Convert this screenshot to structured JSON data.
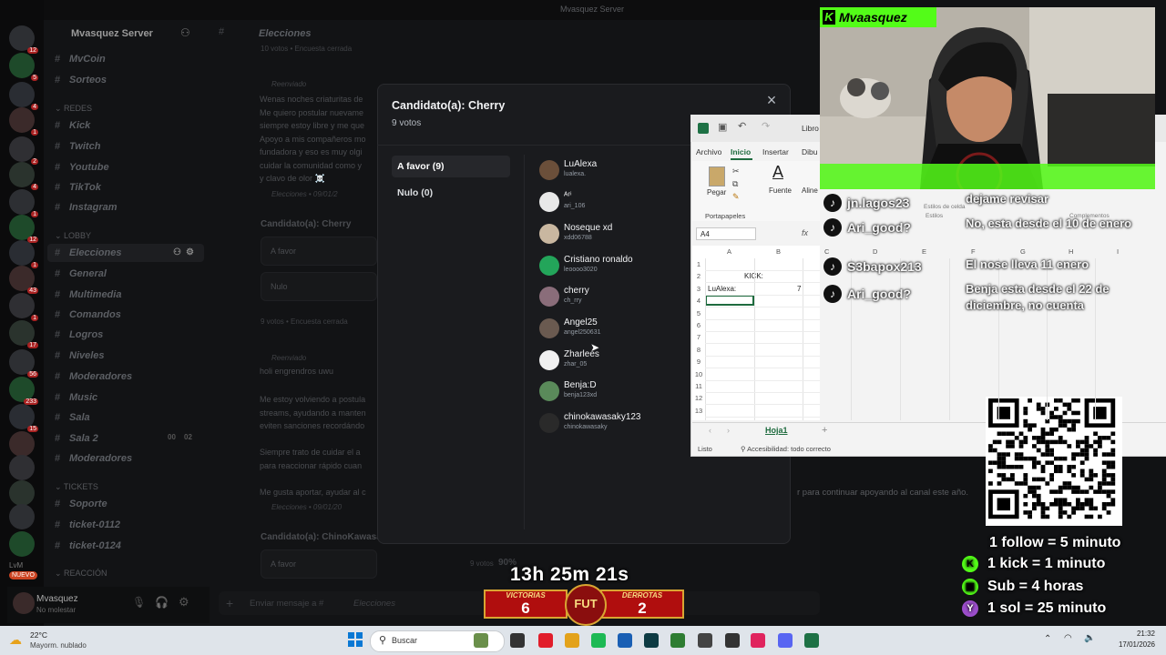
{
  "server": {
    "name": "Mvasquez Server",
    "top_title": "Mvasquez Server",
    "channel_header": "Elecciones",
    "rail_badges": [
      "12",
      "5",
      "4",
      "1",
      "2",
      "4",
      "1",
      "12",
      "1",
      "43",
      "1",
      "17",
      "56",
      "233",
      "15"
    ]
  },
  "sidebar": {
    "channels_top": [
      {
        "label": "MvCoin"
      },
      {
        "label": "Sorteos"
      }
    ],
    "cat_redes": "REDES",
    "redes": [
      {
        "label": "Kick",
        "color": "#53fc18"
      },
      {
        "label": "Twitch",
        "color": "#9146ff"
      },
      {
        "label": "Youtube",
        "color": "#ff0000"
      },
      {
        "label": "TikTok",
        "color": "#ff0050"
      },
      {
        "label": "Instagram",
        "color": "#e1306c"
      }
    ],
    "cat_lobby": "LOBBY",
    "lobby": [
      {
        "label": "Elecciones",
        "active": true
      },
      {
        "label": "General"
      },
      {
        "label": "Multimedia"
      },
      {
        "label": "Comandos"
      },
      {
        "label": "Logros"
      },
      {
        "label": "Niveles"
      },
      {
        "label": "Moderadores"
      },
      {
        "label": "Music"
      },
      {
        "label": "Sala"
      },
      {
        "label": "Sala 2"
      },
      {
        "label": "Moderadores"
      }
    ],
    "sala2_counts": [
      "00",
      "02"
    ],
    "cat_tickets": "TICKETS",
    "tickets": [
      {
        "label": "Soporte"
      },
      {
        "label": "ticket-0112"
      },
      {
        "label": "ticket-0124"
      }
    ],
    "cat_reaccion": "REACCIÓN",
    "nuevo_badge": "NUEVO",
    "user": {
      "name": "Mvasquez",
      "status": "No molestar",
      "initials": "LvM"
    }
  },
  "chat": {
    "reenviado": "Reenviado",
    "msg1": "Wenas noches criaturitas de\nMe quiero postular nuevame\nsiempre estoy libre y me que\nApoyo a mis compañeros mo\nfundadora y eso es muy olgi\ncuidar la comunidad como y\ny clavo de olor ☠️",
    "msg1_meta": "Elecciones • 09/01/2",
    "poll1_title": "Candidato(a): Cherry",
    "poll1_opts": [
      "A favor",
      "Nulo"
    ],
    "poll1_votes": "9 votos",
    "poll1_closed": "Encuesta cerrada",
    "top_votes": "10 votos",
    "top_closed": "Encuesta cerrada",
    "msg2_head": "holi engrendros uwu",
    "msg2": "Me estoy volviendo a postula\nstreams, ayudando a manten\neviten sanciones recordándo\n\nSiempre trato de cuidar el a\npara reaccionar rápido cuan\n\nMe gusta aportar, ayudar al c",
    "msg2_meta": "Elecciones • 09/01/20",
    "poll2_title": "Candidato(a): ChinoKawasa",
    "poll2_opt": "A favor",
    "poll2_votes": "9 votos",
    "poll2_pct": "90%",
    "tail_text": "r para continuar apoyando al canal este año.",
    "input_placeholder": "Enviar mensaje a #",
    "input_channel": "Elecciones"
  },
  "modal": {
    "title": "Candidato(a): Cherry",
    "subtitle": "9 votos",
    "options": [
      {
        "label": "A favor (9)",
        "selected": true
      },
      {
        "label": "Nulo (0)",
        "selected": false
      }
    ],
    "voters": [
      {
        "name": "LuAlexa",
        "user": "lualexa.",
        "color": "#6b4f3a"
      },
      {
        "name": "ᴬʳⁱ",
        "user": "ari_106",
        "color": "#e8e8e8"
      },
      {
        "name": "Noseque xd",
        "user": "xdd06788",
        "color": "#c9b7a0"
      },
      {
        "name": "Cristiano ronaldo",
        "user": "leoooo3020",
        "color": "#23a55a"
      },
      {
        "name": "cherry",
        "user": "ch_rry",
        "color": "#8a6d7a"
      },
      {
        "name": "Angel25",
        "user": "angel250631",
        "color": "#6a5a50"
      },
      {
        "name": "Zharlees",
        "user": "zhar_05",
        "color": "#f0f0f0"
      },
      {
        "name": "Benja:D",
        "user": "benja123xd",
        "color": "#5a8a5a"
      },
      {
        "name": "chinokawasaky123",
        "user": "chinokawasaky",
        "color": "#2a2a2a"
      }
    ]
  },
  "webcam": {
    "tag": "Mvaasquez",
    "tag_icon": "K"
  },
  "excel": {
    "title": "Libro",
    "tabs": [
      "Archivo",
      "Inicio",
      "Insertar",
      "Dibu"
    ],
    "groups": [
      "Portapapeles",
      "Fuente",
      "Aline"
    ],
    "paste_label": "Pegar",
    "namebox": "A4",
    "fx": "fx",
    "cols": [
      "A",
      "B",
      "C",
      "D",
      "E",
      "F",
      "G",
      "H",
      "I"
    ],
    "rows": [
      "1",
      "2",
      "3",
      "4",
      "5",
      "6",
      "7",
      "8",
      "9",
      "10",
      "11",
      "12",
      "13"
    ],
    "cells": {
      "b2": "KICK:",
      "a3": "LuAlexa:",
      "b3": "7"
    },
    "sheet": "Hoja1",
    "status_left": "Listo",
    "status_acc": "Accesibilidad: todo correcto"
  },
  "overlay_chat": {
    "header_fragments": [
      "Estilos",
      "Complementos"
    ],
    "header_fragment_2": "Estilos de celda",
    "messages": [
      {
        "user": "jn.lagos23",
        "text": "dejame revisar"
      },
      {
        "user": "Ari_good?",
        "text": "No, esta desde el 10 de enero"
      },
      {
        "user": "S3bapox213",
        "text": "El nose lleva 11 enero"
      },
      {
        "user": "Ari_good?",
        "text": "Benja esta desde el 22 de diciembre, no cuenta"
      }
    ]
  },
  "rates": [
    {
      "label": "1 follow = 5 minuto",
      "color": "#2d2d2d"
    },
    {
      "label": "1 kick = 1 minuto",
      "color": "#53fc18"
    },
    {
      "label": "Sub = 4 horas",
      "color": "#53fc18"
    },
    {
      "label": "1 sol = 25 minuto",
      "color": "#9b4dca"
    }
  ],
  "stream": {
    "timer": "13h 25m 21s",
    "victorias_label": "VICTORIAS",
    "victorias": "6",
    "derrotas_label": "DERROTAS",
    "derrotas": "2",
    "badge": "FUT"
  },
  "taskbar": {
    "weather_temp": "22°C",
    "weather_desc": "Mayorm. nublado",
    "search": "Buscar",
    "time": "21:32",
    "date": "17/01/2026"
  }
}
